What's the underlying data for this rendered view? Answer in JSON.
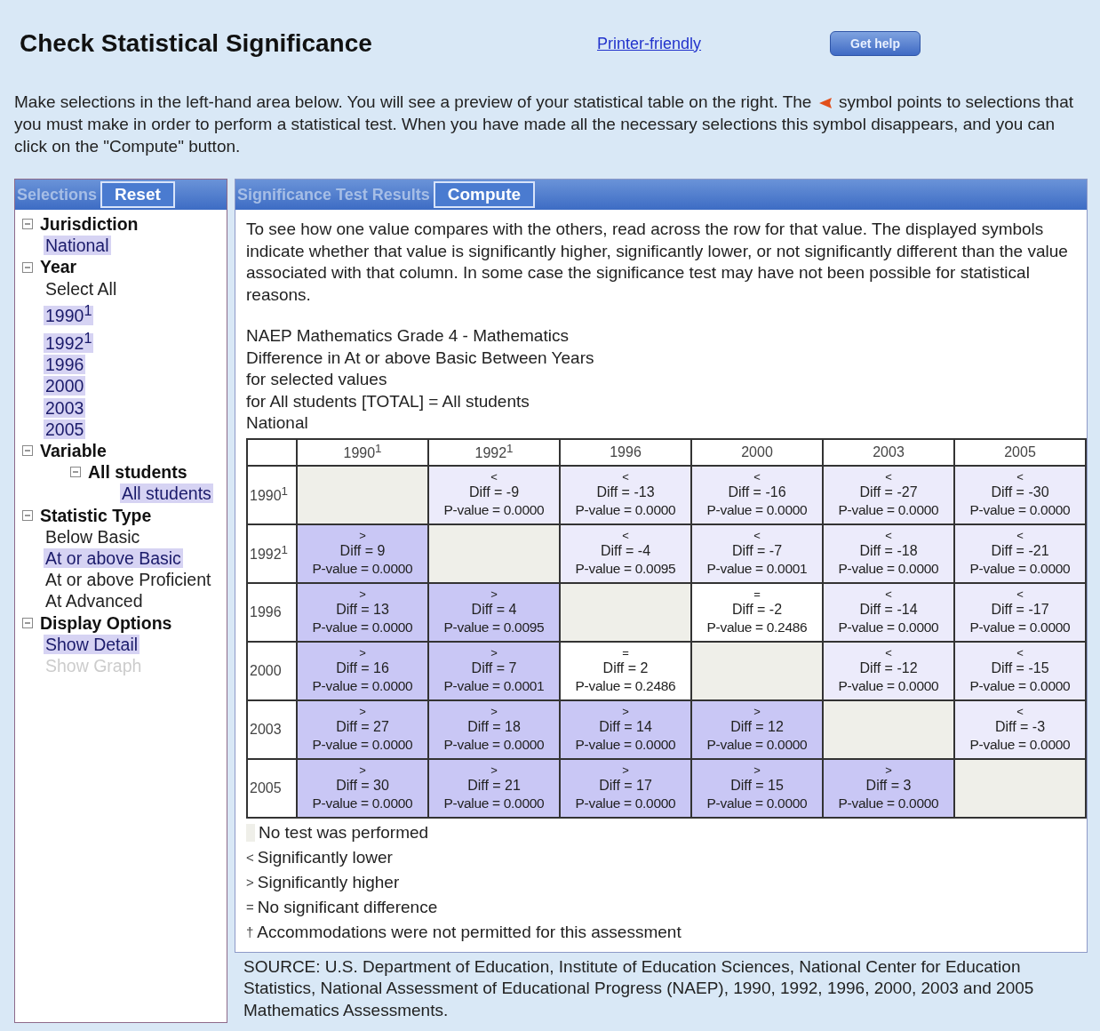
{
  "title": "Check Statistical Significance",
  "printer_link": "Printer-friendly",
  "help_button": "Get help",
  "intro": {
    "before": "Make selections in the left-hand area below. You will see a preview of your statistical table on the right. The",
    "after": "symbol points to selections that you must make in order to perform a statistical test. When you have made all the necessary selections this symbol disappears, and you can click on the \"Compute\" button."
  },
  "selections_panel": {
    "title": "Selections",
    "button": "Reset",
    "tree": [
      {
        "label": "Jurisdiction",
        "expanded": true,
        "children": [
          {
            "label": "National",
            "selected": true,
            "disabled": false
          }
        ]
      },
      {
        "label": "Year",
        "expanded": true,
        "children": [
          {
            "label": "Select All",
            "selected": false,
            "disabled": false
          },
          {
            "label": "1990$^{1}$",
            "selected": true,
            "disabled": false
          },
          {
            "label": "1992$^{1}$",
            "selected": true,
            "disabled": false
          },
          {
            "label": "1996",
            "selected": true,
            "disabled": false
          },
          {
            "label": "2000",
            "selected": true,
            "disabled": false
          },
          {
            "label": "2003",
            "selected": true,
            "disabled": false
          },
          {
            "label": "2005",
            "selected": true,
            "disabled": false
          }
        ]
      },
      {
        "label": "Variable",
        "expanded": true,
        "children": [
          {
            "label": "All students",
            "expanded": true,
            "children": [
              {
                "label": "All students",
                "selected": true,
                "disabled": false
              }
            ]
          }
        ]
      },
      {
        "label": "Statistic Type",
        "expanded": true,
        "children": [
          {
            "label": "Below Basic",
            "selected": false,
            "disabled": false
          },
          {
            "label": "At or above Basic",
            "selected": true,
            "disabled": false
          },
          {
            "label": "At or above Proficient",
            "selected": false,
            "disabled": false
          },
          {
            "label": "At Advanced",
            "selected": false,
            "disabled": false
          }
        ]
      },
      {
        "label": "Display Options",
        "expanded": true,
        "children": [
          {
            "label": "Show Detail",
            "selected": true,
            "disabled": false
          },
          {
            "label": "Show Graph",
            "selected": false,
            "disabled": true
          }
        ]
      }
    ]
  },
  "results_panel": {
    "title": "Significance Test Results",
    "button": "Compute",
    "description": "To see how one value compares with the others, read across the row for that value. The displayed symbols indicate whether that value is significantly higher, significantly lower, or not significantly different than the value associated with that column. In some case the significance test may have not been possible for statistical reasons.",
    "table_title": [
      "NAEP Mathematics Grade 4 - Mathematics",
      "Difference in At or above Basic Between Years",
      "for selected values",
      "for All students [TOTAL] = All students",
      "National"
    ],
    "table": {
      "columns": [
        "1990$^{1}$",
        "1992$^{1}$",
        "1996",
        "2000",
        "2003",
        "2005"
      ],
      "rows": [
        {
          "label": "1990$^{1}$",
          "cells": [
            {
              "kind": "none"
            },
            {
              "kind": "lower",
              "symbol": "<",
              "diff": "Diff = -9",
              "p_value": "P-value = 0.0000"
            },
            {
              "kind": "lower",
              "symbol": "<",
              "diff": "Diff = -13",
              "p_value": "P-value = 0.0000"
            },
            {
              "kind": "lower",
              "symbol": "<",
              "diff": "Diff = -16",
              "p_value": "P-value = 0.0000"
            },
            {
              "kind": "lower",
              "symbol": "<",
              "diff": "Diff = -27",
              "p_value": "P-value = 0.0000"
            },
            {
              "kind": "lower",
              "symbol": "<",
              "diff": "Diff = -30",
              "p_value": "P-value = 0.0000"
            }
          ]
        },
        {
          "label": "1992$^{1}$",
          "cells": [
            {
              "kind": "higher",
              "symbol": ">",
              "diff": "Diff = 9",
              "p_value": "P-value = 0.0000"
            },
            {
              "kind": "none"
            },
            {
              "kind": "lower",
              "symbol": "<",
              "diff": "Diff = -4",
              "p_value": "P-value = 0.0095"
            },
            {
              "kind": "lower",
              "symbol": "<",
              "diff": "Diff = -7",
              "p_value": "P-value = 0.0001"
            },
            {
              "kind": "lower",
              "symbol": "<",
              "diff": "Diff = -18",
              "p_value": "P-value = 0.0000"
            },
            {
              "kind": "lower",
              "symbol": "<",
              "diff": "Diff = -21",
              "p_value": "P-value = 0.0000"
            }
          ]
        },
        {
          "label": "1996",
          "cells": [
            {
              "kind": "higher",
              "symbol": ">",
              "diff": "Diff = 13",
              "p_value": "P-value = 0.0000"
            },
            {
              "kind": "higher",
              "symbol": ">",
              "diff": "Diff = 4",
              "p_value": "P-value = 0.0095"
            },
            {
              "kind": "none"
            },
            {
              "kind": "equal",
              "symbol": "=",
              "diff": "Diff = -2",
              "p_value": "P-value = 0.2486"
            },
            {
              "kind": "lower",
              "symbol": "<",
              "diff": "Diff = -14",
              "p_value": "P-value = 0.0000"
            },
            {
              "kind": "lower",
              "symbol": "<",
              "diff": "Diff = -17",
              "p_value": "P-value = 0.0000"
            }
          ]
        },
        {
          "label": "2000",
          "cells": [
            {
              "kind": "higher",
              "symbol": ">",
              "diff": "Diff = 16",
              "p_value": "P-value = 0.0000"
            },
            {
              "kind": "higher",
              "symbol": ">",
              "diff": "Diff = 7",
              "p_value": "P-value = 0.0001"
            },
            {
              "kind": "equal",
              "symbol": "=",
              "diff": "Diff = 2",
              "p_value": "P-value = 0.2486"
            },
            {
              "kind": "none"
            },
            {
              "kind": "lower",
              "symbol": "<",
              "diff": "Diff = -12",
              "p_value": "P-value = 0.0000"
            },
            {
              "kind": "lower",
              "symbol": "<",
              "diff": "Diff = -15",
              "p_value": "P-value = 0.0000"
            }
          ]
        },
        {
          "label": "2003",
          "cells": [
            {
              "kind": "higher",
              "symbol": ">",
              "diff": "Diff = 27",
              "p_value": "P-value = 0.0000"
            },
            {
              "kind": "higher",
              "symbol": ">",
              "diff": "Diff = 18",
              "p_value": "P-value = 0.0000"
            },
            {
              "kind": "higher",
              "symbol": ">",
              "diff": "Diff = 14",
              "p_value": "P-value = 0.0000"
            },
            {
              "kind": "higher",
              "symbol": ">",
              "diff": "Diff = 12",
              "p_value": "P-value = 0.0000"
            },
            {
              "kind": "none"
            },
            {
              "kind": "lower",
              "symbol": "<",
              "diff": "Diff = -3",
              "p_value": "P-value = 0.0000"
            }
          ]
        },
        {
          "label": "2005",
          "cells": [
            {
              "kind": "higher",
              "symbol": ">",
              "diff": "Diff = 30",
              "p_value": "P-value = 0.0000"
            },
            {
              "kind": "higher",
              "symbol": ">",
              "diff": "Diff = 21",
              "p_value": "P-value = 0.0000"
            },
            {
              "kind": "higher",
              "symbol": ">",
              "diff": "Diff = 17",
              "p_value": "P-value = 0.0000"
            },
            {
              "kind": "higher",
              "symbol": ">",
              "diff": "Diff = 15",
              "p_value": "P-value = 0.0000"
            },
            {
              "kind": "higher",
              "symbol": ">",
              "diff": "Diff = 3",
              "p_value": "P-value = 0.0000"
            },
            {
              "kind": "none"
            }
          ]
        }
      ]
    },
    "legend": [
      {
        "kind": "swatch",
        "text": "No test was performed"
      },
      {
        "kind": "symbol",
        "symbol": "<",
        "text": "Significantly lower"
      },
      {
        "kind": "symbol",
        "symbol": ">",
        "text": "Significantly higher"
      },
      {
        "kind": "symbol",
        "symbol": "=",
        "text": "No significant difference"
      },
      {
        "kind": "symbol",
        "symbol": "†",
        "text": "Accommodations were not permitted for this assessment"
      }
    ]
  },
  "source": "SOURCE: U.S. Department of Education, Institute of Education Sciences, National Center for Education Statistics, National Assessment of Educational Progress (NAEP), 1990, 1992, 1996, 2000, 2003 and 2005 Mathematics Assessments."
}
